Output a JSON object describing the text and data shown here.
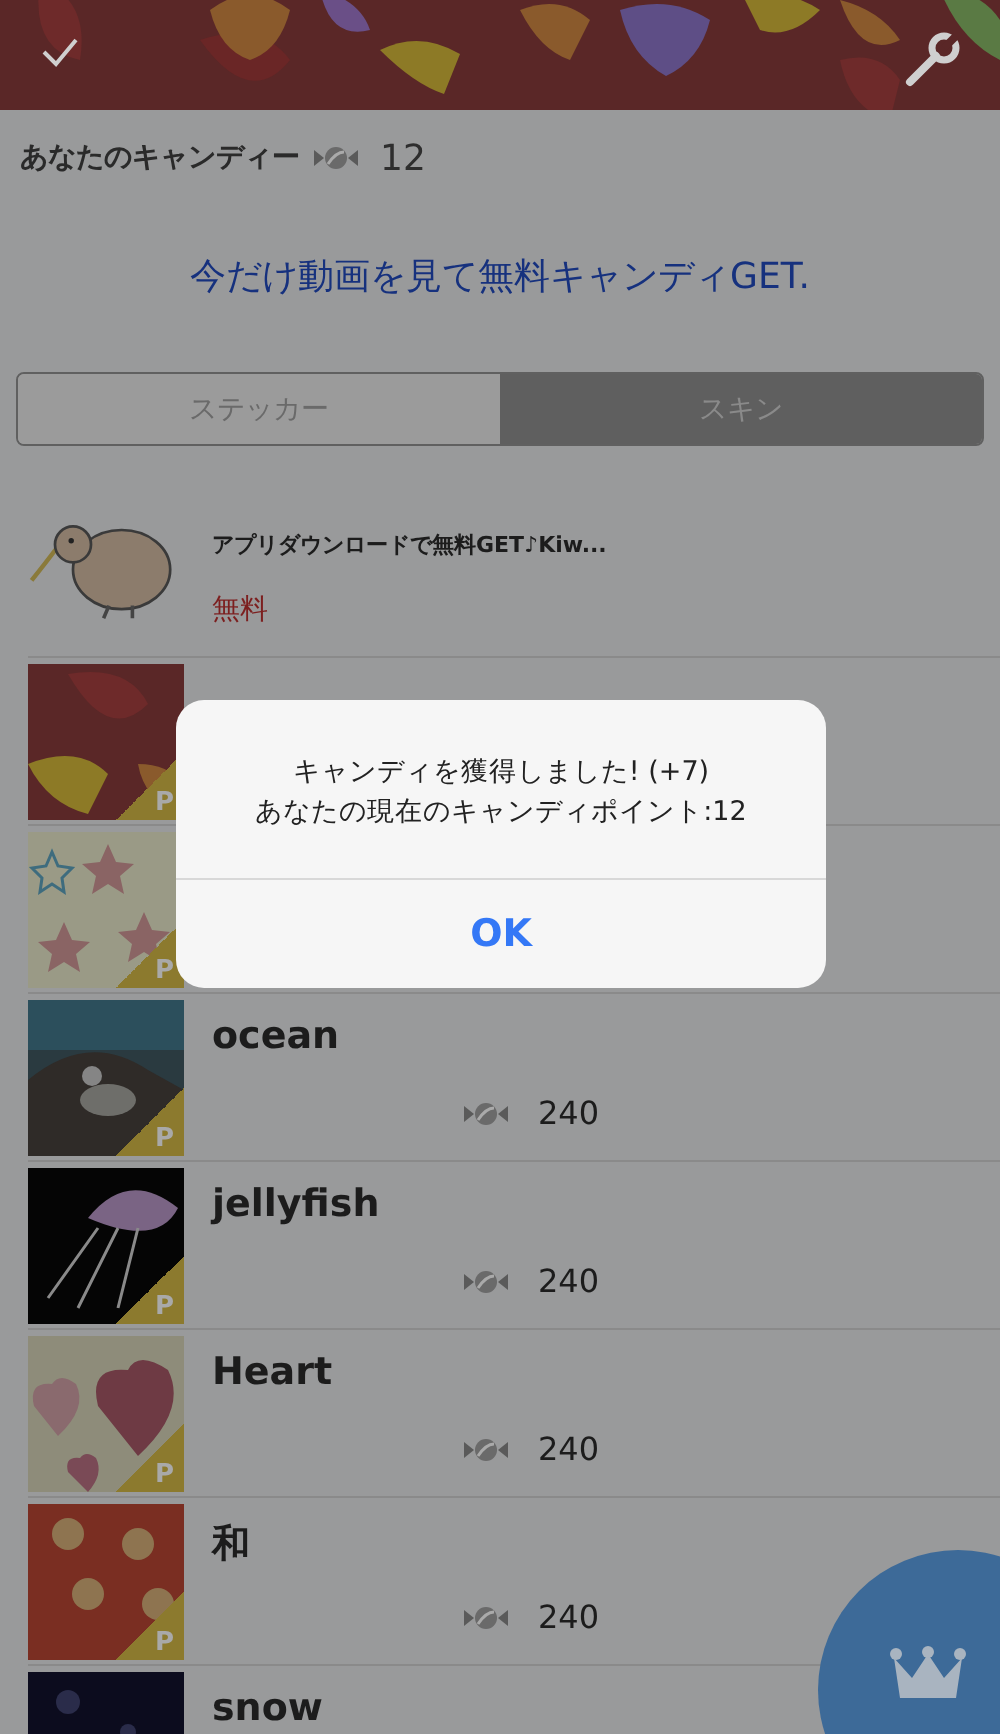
{
  "candy_balance": {
    "label": "あなたのキャンディー",
    "count": "12"
  },
  "promo_link": "今だけ動画を見て無料キャンディGET.",
  "tabs": [
    {
      "label": "ステッカー",
      "selected": false
    },
    {
      "label": "スキン",
      "selected": true
    }
  ],
  "items": [
    {
      "kind": "app",
      "title": "アプリダウンロードで無料GET♪Kiw...",
      "price": "無料"
    },
    {
      "kind": "skin",
      "badge": "P"
    },
    {
      "kind": "skin",
      "badge": "P"
    },
    {
      "kind": "skin",
      "title": "ocean",
      "price": "240",
      "badge": "P"
    },
    {
      "kind": "skin",
      "title": "jellyfish",
      "price": "240",
      "badge": "P"
    },
    {
      "kind": "skin",
      "title": "Heart",
      "price": "240",
      "badge": "P"
    },
    {
      "kind": "skin",
      "title": "和",
      "price": "240",
      "badge": "P"
    },
    {
      "kind": "skin",
      "title": "snow"
    }
  ],
  "alert": {
    "message": [
      "キャンディを獲得しました! (+7)",
      "あなたの現在のキャンディポイント:12"
    ],
    "button": "OK"
  }
}
